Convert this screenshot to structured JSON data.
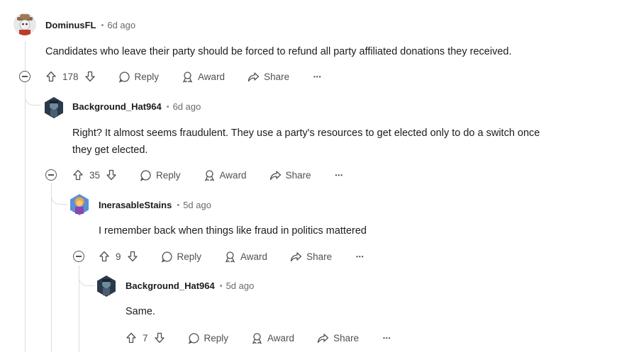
{
  "comments": [
    {
      "author": "DominusFL",
      "time": "6d ago",
      "body": [
        "Candidates who leave their party should be forced to refund all party affiliated donations they received."
      ],
      "score": "178"
    },
    {
      "author": "Background_Hat964",
      "time": "6d ago",
      "body": [
        "Right? It almost seems fraudulent. They use a party's resources to get elected only to do a switch once",
        "they get elected."
      ],
      "score": "35"
    },
    {
      "author": "InerasableStains",
      "time": "5d ago",
      "body": [
        "I remember back when things like fraud in politics mattered"
      ],
      "score": "9"
    },
    {
      "author": "Background_Hat964",
      "time": "5d ago",
      "body": [
        "Same."
      ],
      "score": "7"
    }
  ],
  "labels": {
    "separator": "•",
    "reply": "Reply",
    "award": "Award",
    "share": "Share",
    "more": "•••"
  },
  "icons": {
    "upvote": "arrow-up-icon",
    "downvote": "arrow-down-icon",
    "reply": "speech-bubble-icon",
    "award": "award-ribbon-icon",
    "share": "share-arrow-icon",
    "collapse": "collapse-minus-icon"
  }
}
